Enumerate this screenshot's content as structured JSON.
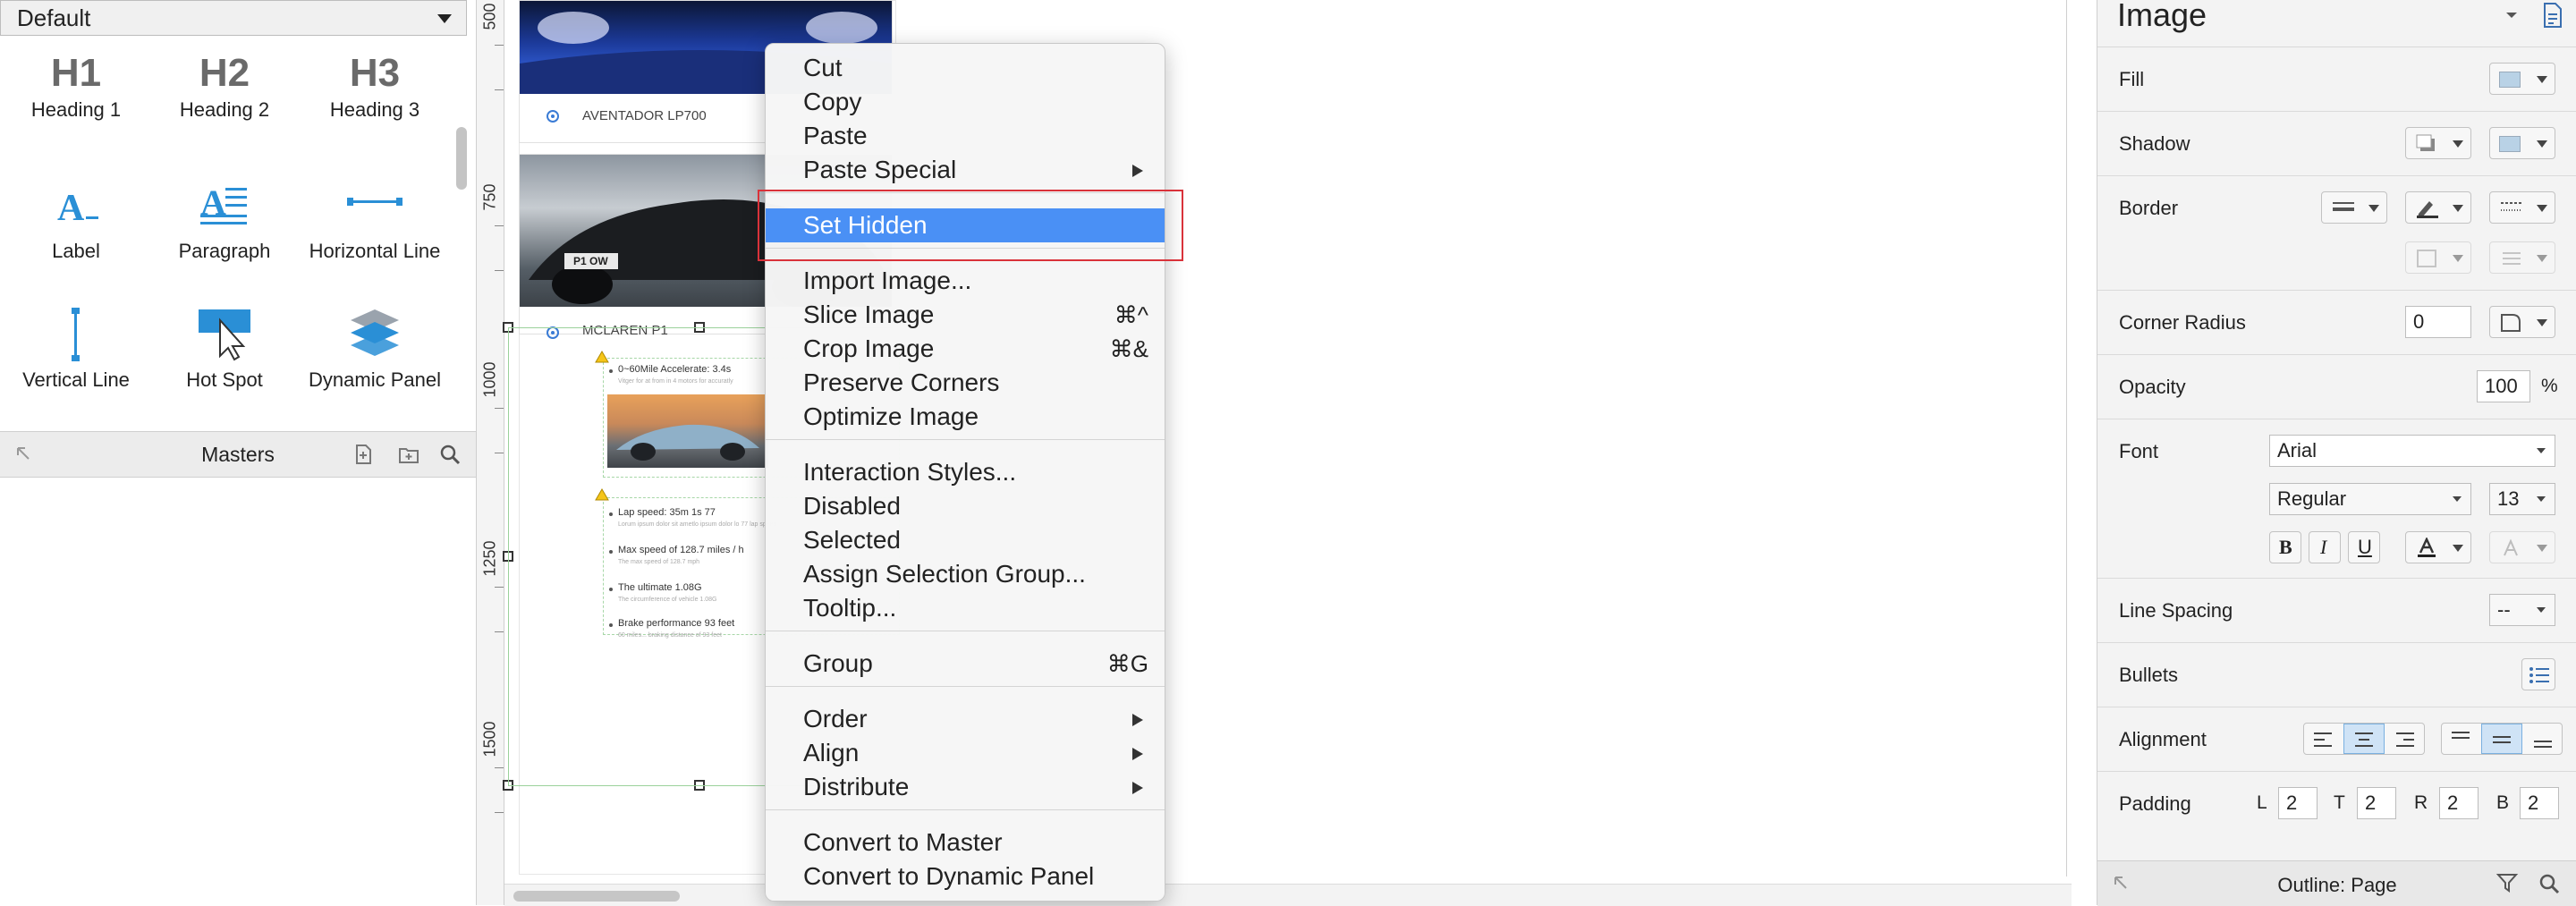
{
  "left_panel": {
    "library_select": "Default",
    "widgets": [
      {
        "id": "heading1",
        "icon_text": "H1",
        "label": "Heading 1"
      },
      {
        "id": "heading2",
        "icon_text": "H2",
        "label": "Heading 2"
      },
      {
        "id": "heading3",
        "icon_text": "H3",
        "label": "Heading 3"
      },
      {
        "id": "label",
        "icon_text": "A_",
        "label": "Label"
      },
      {
        "id": "paragraph",
        "icon_text": "A",
        "label": "Paragraph"
      },
      {
        "id": "hline",
        "icon_text": "",
        "label": "Horizontal Line"
      },
      {
        "id": "vline",
        "icon_text": "",
        "label": "Vertical Line"
      },
      {
        "id": "hotspot",
        "icon_text": "",
        "label": "Hot Spot"
      },
      {
        "id": "dpanel",
        "icon_text": "",
        "label": "Dynamic Panel"
      }
    ],
    "masters_title": "Masters"
  },
  "ruler": {
    "ticks": [
      "500",
      "750",
      "1000",
      "1250",
      "1500"
    ]
  },
  "canvas": {
    "card1_caption": "AVENTADOR LP700",
    "card2_caption": "MCLAREN P1",
    "plate_text": "P1 OW",
    "features": [
      {
        "title": "0~60Mile Accelerate: 3.4s",
        "sub": "Vitger for at from in 4 motors for accuratly"
      },
      {
        "title": "Lap speed: 35m 1s 77",
        "sub": "Lorum ipsum dolor sit ametlo ipsum dolor lo 77 lap speed"
      },
      {
        "title": "Max speed of 128.7 miles / h",
        "sub": "The max speed of 128.7 mph"
      },
      {
        "title": "The ultimate 1.08G",
        "sub": "The circumference of vehicle 1.08G"
      },
      {
        "title": "Brake performance 93 feet",
        "sub": "60 miles... braking distance of 93 feet"
      }
    ]
  },
  "context_menu": {
    "items": [
      {
        "label": "Cut",
        "shortcut": "",
        "submenu": false,
        "highlighted": false
      },
      {
        "label": "Copy",
        "shortcut": "",
        "submenu": false,
        "highlighted": false
      },
      {
        "label": "Paste",
        "shortcut": "",
        "submenu": false,
        "highlighted": false
      },
      {
        "label": "Paste Special",
        "shortcut": "",
        "submenu": true,
        "highlighted": false
      },
      {
        "label": "Set Hidden",
        "shortcut": "",
        "submenu": false,
        "highlighted": true
      },
      {
        "label": "Import Image...",
        "shortcut": "",
        "submenu": false,
        "highlighted": false
      },
      {
        "label": "Slice Image",
        "shortcut": "⌘^",
        "submenu": false,
        "highlighted": false
      },
      {
        "label": "Crop Image",
        "shortcut": "⌘&",
        "submenu": false,
        "highlighted": false
      },
      {
        "label": "Preserve Corners",
        "shortcut": "",
        "submenu": false,
        "highlighted": false
      },
      {
        "label": "Optimize Image",
        "shortcut": "",
        "submenu": false,
        "highlighted": false
      },
      {
        "label": "Interaction Styles...",
        "shortcut": "",
        "submenu": false,
        "highlighted": false
      },
      {
        "label": "Disabled",
        "shortcut": "",
        "submenu": false,
        "highlighted": false
      },
      {
        "label": "Selected",
        "shortcut": "",
        "submenu": false,
        "highlighted": false
      },
      {
        "label": "Assign Selection Group...",
        "shortcut": "",
        "submenu": false,
        "highlighted": false
      },
      {
        "label": "Tooltip...",
        "shortcut": "",
        "submenu": false,
        "highlighted": false
      },
      {
        "label": "Group",
        "shortcut": "⌘G",
        "submenu": false,
        "highlighted": false
      },
      {
        "label": "Order",
        "shortcut": "",
        "submenu": true,
        "highlighted": false
      },
      {
        "label": "Align",
        "shortcut": "",
        "submenu": true,
        "highlighted": false
      },
      {
        "label": "Distribute",
        "shortcut": "",
        "submenu": true,
        "highlighted": false
      },
      {
        "label": "Convert to Master",
        "shortcut": "",
        "submenu": false,
        "highlighted": false
      },
      {
        "label": "Convert to Dynamic Panel",
        "shortcut": "",
        "submenu": false,
        "highlighted": false
      }
    ]
  },
  "right_panel": {
    "title": "Image",
    "fill_label": "Fill",
    "shadow_label": "Shadow",
    "border_label": "Border",
    "corner_radius_label": "Corner Radius",
    "corner_radius_value": "0",
    "opacity_label": "Opacity",
    "opacity_value": "100",
    "opacity_unit": "%",
    "font_label": "Font",
    "font_family": "Arial",
    "font_weight": "Regular",
    "font_size": "13",
    "line_spacing_label": "Line Spacing",
    "line_spacing_value": "--",
    "bullets_label": "Bullets",
    "alignment_label": "Alignment",
    "padding_label": "Padding",
    "padding": {
      "L": "2",
      "T": "2",
      "R": "2",
      "B": "2"
    },
    "outline_title": "Outline: Page",
    "colors": {
      "swatch": "#b9d2e6",
      "accent": "#4a90f5"
    }
  }
}
